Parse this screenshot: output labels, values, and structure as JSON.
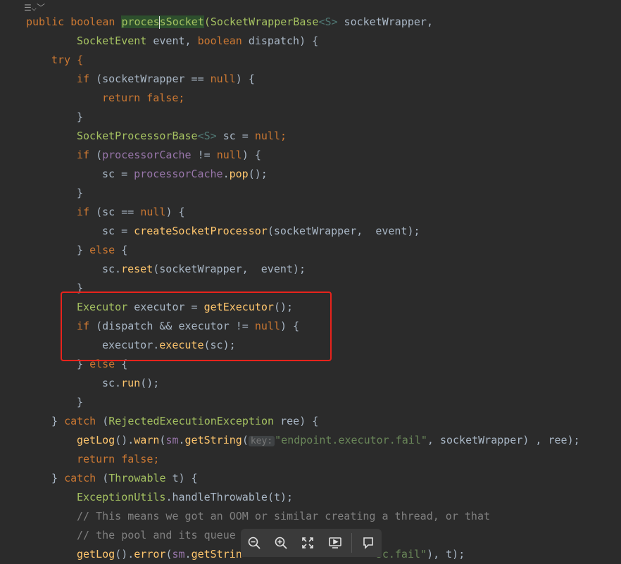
{
  "fold_icon": "fold-marker-icon",
  "toolbar": {
    "zoom_out_icon": "zoom-out-icon",
    "zoom_in_icon": "zoom-in-icon",
    "fullscreen_icon": "fullscreen-icon",
    "slideshow_icon": "slideshow-icon",
    "comment_icon": "comment-icon"
  },
  "code": {
    "l1": {
      "a": "public boolean ",
      "b": "proces",
      "c": "sSocket",
      "d": "(SocketWrapperBase",
      "e": "<S>",
      "f": " socketWrapper,"
    },
    "l2": {
      "a": "SocketEvent",
      " b": "",
      "b2": " event, ",
      "c": "boolean",
      " d": "",
      "d2": " dispatch) {"
    },
    "l3": {
      "a": "try {"
    },
    "l4": {
      "a": "if ",
      "b": "(socketWrapper == ",
      "c": "null",
      ")": ") {"
    },
    "l5": {
      "a": "return false",
      ";": ";"
    },
    "l6": {
      "a": "}"
    },
    "l7": {
      "a": "SocketProcessorBase",
      "b": "<S>",
      "c": " sc = ",
      "d": "null",
      ";": ";"
    },
    "l8": {
      "a": "if ",
      "b": "(",
      "c": "processorCache",
      " d": " != ",
      "e": "null",
      ")": ") {"
    },
    "l9": {
      "a": "sc = ",
      "b": "processorCache",
      ".": ".",
      "c": "pop",
      "d": "();"
    },
    "l10": {
      "a": "}"
    },
    "l11": {
      "a": "if ",
      "b": "(sc == ",
      "c": "null",
      ")": ") {"
    },
    "l12": {
      "a": "sc = ",
      "b": "createSocketProcessor",
      "c": "(socketWrapper, ",
      "d": " event);"
    },
    "l13": {
      "a": "} ",
      "b": "else",
      " c": " {"
    },
    "l14": {
      "a": "sc.",
      "b": "reset",
      "c": "(socketWrapper, ",
      "d": " event);"
    },
    "l15": {
      "a": "}"
    },
    "l16": {
      "a": "Executor",
      " b": " executor = ",
      "c": "getExecutor",
      "d": "();"
    },
    "l17": {
      "a": "if ",
      "b": "(dispatch && executor != ",
      "c": "null",
      ")": ") {"
    },
    "l18": {
      "a": "executor.",
      "b": "execute",
      "c": "(sc);"
    },
    "l19": {
      "a": "} ",
      "b": "else",
      " c": " {"
    },
    "l20": {
      "a": "sc.",
      "b": "run",
      "c": "();"
    },
    "l21": {
      "a": "}"
    },
    "l22": {
      "a": "} ",
      "b": "catch ",
      "c": "(",
      "d": "RejectedExecutionException",
      " e": " ree) {"
    },
    "l23": {
      "a": "getLog",
      "b": "().",
      "c": "warn",
      "d": "(",
      "e": "sm",
      ".": ".",
      "f": "getString",
      "g": "(",
      "hint": "key:",
      "h": "\"endpoint.executor.fail\"",
      "i": ", socketWrapper) , ree);"
    },
    "l24": {
      "a": "return false",
      ";": ";"
    },
    "l25": {
      "a": "} ",
      "b": "catch ",
      "c": "(",
      "d": "Throwable",
      " e": " t) {"
    },
    "l26": {
      "a": "ExceptionUtils",
      ".": ".",
      "b": "handleThrowable",
      "c": "(t);"
    },
    "l27": {
      "a": "// This means we got an OOM or similar creating a thread, or that"
    },
    "l28": {
      "a": "// the pool and its queue"
    },
    "l29": {
      "a": "getLog",
      "b": "().",
      "c": "error",
      "d": "(",
      "e": "sm",
      ".": ".",
      "f": "getStrin",
      "g": "",
      "h": "sc.fail\"",
      "i": "), t);"
    }
  }
}
